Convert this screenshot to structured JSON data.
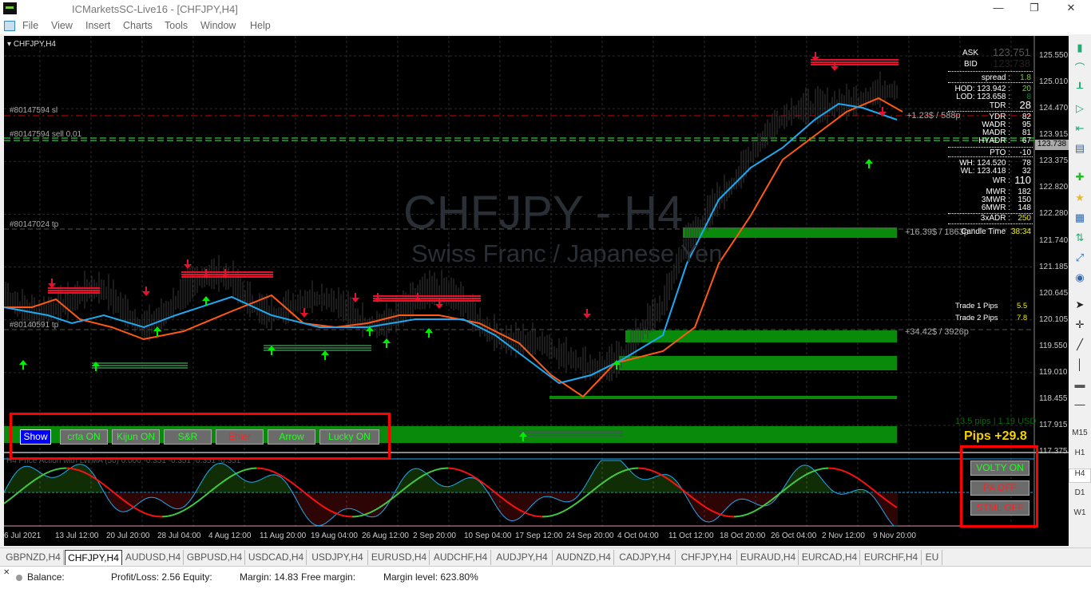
{
  "window": {
    "title": "ICMarketsSC-Live16 - [CHFJPY,H4]",
    "controls": [
      "—",
      "❐",
      "✕"
    ]
  },
  "menu": [
    "File",
    "View",
    "Insert",
    "Charts",
    "Tools",
    "Window",
    "Help"
  ],
  "chart": {
    "symbol_label": "CHFJPY,H4",
    "watermark_symbol": "CHFJPY - H4",
    "watermark_desc": "Swiss Franc / Japanese Yen",
    "order_labels": {
      "sl": "#80147594 sl",
      "sell": "#80147594 sell 0.01",
      "tp1": "#80147024 tp",
      "tp2": "#80140591 tp"
    },
    "line_labels": {
      "a": "+1.23$ / 588p",
      "b": "+16.39$ / 1863p",
      "c": "+34.42$ / 3926p"
    },
    "current_price": "123.738",
    "price_axis": [
      "125.550",
      "125.010",
      "124.470",
      "123.915",
      "123.375",
      "122.820",
      "122.280",
      "121.740",
      "121.185",
      "120.645",
      "120.105",
      "119.550",
      "119.010",
      "118.455",
      "117.915",
      "117.375"
    ],
    "time_axis": [
      "6 Jul 2021",
      "13 Jul 12:00",
      "20 Jul 20:00",
      "28 Jul 04:00",
      "4 Aug 12:00",
      "11 Aug 20:00",
      "19 Aug 04:00",
      "26 Aug 12:00",
      "2 Sep 20:00",
      "10 Sep 04:00",
      "17 Sep 12:00",
      "24 Sep 20:00",
      "4 Oct 04:00",
      "11 Oct 12:00",
      "18 Oct 20:00",
      "26 Oct 04:00",
      "2 Nov 12:00",
      "9 Nov 20:00"
    ],
    "indicator_label": "H4 Price Action with LWMA (50) 0.000 -0.351 -0.351 -0.351 -0.351"
  },
  "info_panel": {
    "ask_label": "ASK",
    "ask": "123.751",
    "bid_label": "BID",
    "bid": "123.738",
    "rows": [
      {
        "label": "spread :",
        "value": "1.8"
      },
      {
        "label": "HOD: 123.942 :",
        "value": "20"
      },
      {
        "label": "LOD: 123.658 :",
        "value": "8"
      },
      {
        "label": "TDR :",
        "value": "28"
      },
      {
        "label": "YDR :",
        "value": "82"
      },
      {
        "label": "WADR :",
        "value": "95"
      },
      {
        "label": "MADR :",
        "value": "81"
      },
      {
        "label": "HYADR :",
        "value": "67"
      },
      {
        "label": "PTO :",
        "value": "-10"
      },
      {
        "label": "WH: 124.520 :",
        "value": "78"
      },
      {
        "label": "WL: 123.418 :",
        "value": "32"
      },
      {
        "label": "WR :",
        "value": "110"
      },
      {
        "label": "MWR :",
        "value": "182"
      },
      {
        "label": "3MWR :",
        "value": "150"
      },
      {
        "label": "6MWR :",
        "value": "148"
      },
      {
        "label": "3xADR :",
        "value": "250"
      }
    ],
    "candle_time_label": "Candle Time",
    "candle_time": "38:34",
    "trade1_label": "Trade 1 Pips",
    "trade1": "5.5",
    "trade2_label": "Trade 2 Pips",
    "trade2": "7.8",
    "pips_usd": "13.5 pips | 1.19 USD",
    "pips_total": "Pips +29.8"
  },
  "buttons": {
    "show": "Show",
    "crta": "crta ON",
    "kijun": "Kijun ON",
    "sr": "S&R",
    "ehler": "Ehler",
    "arrow": "Arrow",
    "lucky": "Lucky ON",
    "volty": "VOLTY ON",
    "pa": "PA OFF",
    "stml": "STML OFF"
  },
  "timeframes": [
    "M15",
    "H1",
    "H4",
    "D1",
    "W1"
  ],
  "tabs": [
    "GBPNZD,H4",
    "CHFJPY,H4",
    "AUDUSD,H4",
    "GBPUSD,H4",
    "USDCAD,H4",
    "USDJPY,H4",
    "EURUSD,H4",
    "AUDCHF,H4",
    "AUDJPY,H4",
    "AUDNZD,H4",
    "CADJPY,H4",
    "CHFJPY,H4",
    "EURAUD,H4",
    "EURCAD,H4",
    "EURCHF,H4",
    "EU"
  ],
  "status": {
    "balance": "Balance:",
    "pl": "Profit/Loss: 2.56",
    "equity": "Equity:",
    "margin": "Margin: 14.83",
    "free": "Free margin:",
    "level": "Margin level: 623.80%"
  },
  "colors": {
    "bg": "#000000",
    "blue_ma": "#1eaaf0",
    "orange_ma": "#ff5a14",
    "zone": "#0a8a0a",
    "up": "#00ee00",
    "down": "#e8102a"
  }
}
